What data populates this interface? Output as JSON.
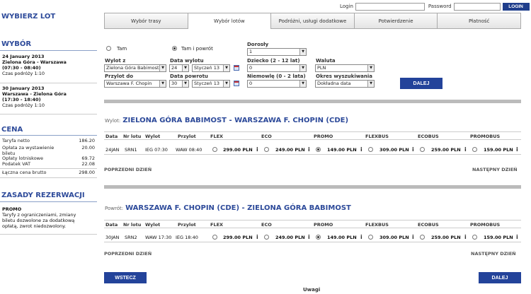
{
  "login": {
    "login_label": "Login",
    "password_label": "Password",
    "button": "LOGIN"
  },
  "sidebar": {
    "title": "WYBIERZ LOT",
    "choice_title": "WYBÓR",
    "flight1": {
      "date": "24 January 2013",
      "route": "Zielona Góra - Warszawa",
      "time": "(07:30 - 08:40)",
      "duration": "Czas podróży 1:10"
    },
    "flight2": {
      "date": "30 January 2013",
      "route": "Warszawa - Zielona Góra",
      "time": "(17:30 - 18:40)",
      "duration": "Czas podróży 1:10"
    },
    "price_title": "CENA",
    "prices": [
      {
        "label": "Taryfa netto",
        "value": "186.20"
      },
      {
        "label": "Opłata za wystawienie",
        "value": "20.00"
      },
      {
        "label": "biletu",
        "value": ""
      },
      {
        "label": "Opłaty lotniskowe",
        "value": "69.72"
      },
      {
        "label": "Podatek VAT",
        "value": "22.08"
      }
    ],
    "total": {
      "label": "Łączna cena brutto",
      "value": "298.00"
    },
    "rules_title": "ZASADY REZERWACJI",
    "rules_name": "PROMO",
    "rules_text_1": "Taryfy z ograniczeniami, zmiany",
    "rules_text_2": "biletu dozwolone za dodatkową",
    "rules_text_3": "opłatą, zwrot niedozwolony."
  },
  "tabs": [
    "Wybór trasy",
    "Wybór lotów",
    "Podróżni, usługi dodatkowe",
    "Potwierdzenie",
    "Płatność"
  ],
  "form": {
    "oneway": "Tam",
    "roundtrip": "Tam i powrót",
    "from_label": "Wylot z",
    "from_value": "Zielona Góra Babimost",
    "depdate_label": "Data wylotu",
    "dep_day": "24",
    "dep_month": "Styczeń 13",
    "to_label": "Przylot do",
    "to_value": "Warszawa F. Chopin",
    "retdate_label": "Data powrotu",
    "ret_day": "30",
    "ret_month": "Styczeń 13",
    "adults_label": "Dorosły",
    "adults_value": "1",
    "child_label": "Dziecko (2 - 12 lat)",
    "child_value": "0",
    "infant_label": "Niemowlę (0 - 2 lata)",
    "infant_value": "0",
    "currency_label": "Waluta",
    "currency_value": "PLN",
    "search_label": "Okres wyszukiwania",
    "search_value": "Dokładna data",
    "submit": "DALEJ"
  },
  "columns": [
    "Data",
    "Nr lotu",
    "Wylot",
    "Przylot",
    "FLEX",
    "ECO",
    "PROMO",
    "FLEXBUS",
    "ECOBUS",
    "PROMOBUS"
  ],
  "outbound": {
    "prefix": "Wylot:",
    "route": "ZIELONA GÓRA BABIMOST - WARSZAWA F. CHOPIN (CDE)",
    "row": {
      "date": "24JAN",
      "flight": "SRN1",
      "dep": "IEG 07:30",
      "arr": "WAW 08:40",
      "prices": [
        "299.00 PLN",
        "249.00 PLN",
        "149.00 PLN",
        "309.00 PLN",
        "259.00 PLN",
        "159.00 PLN"
      ]
    }
  },
  "inbound": {
    "prefix": "Powrót:",
    "route": "WARSZAWA F. CHOPIN (CDE) - ZIELONA GÓRA BABIMOST",
    "row": {
      "date": "30JAN",
      "flight": "SRN2",
      "dep": "WAW 17:30",
      "arr": "IEG 18:40",
      "prices": [
        "299.00 PLN",
        "249.00 PLN",
        "149.00 PLN",
        "309.00 PLN",
        "259.00 PLN",
        "159.00 PLN"
      ]
    }
  },
  "nav": {
    "prev": "POPRZEDNI DZIEŃ",
    "next": "NASTĘPNY DZIEŃ",
    "info": "i"
  },
  "footer": {
    "back": "WSTECZ",
    "next": "DALEJ",
    "notes": "Uwagi"
  }
}
